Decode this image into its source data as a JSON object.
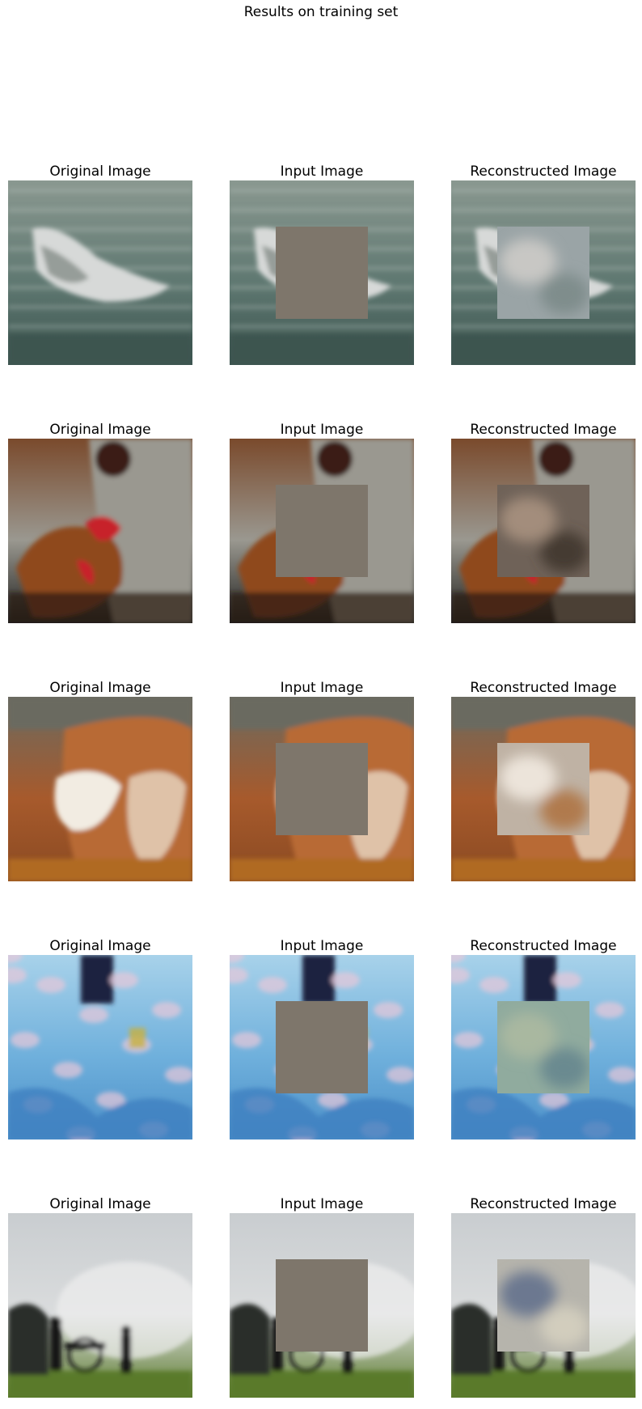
{
  "figure": {
    "title": "Results on training set",
    "column_titles": [
      "Original Image",
      "Input Image",
      "Reconstructed Image"
    ]
  },
  "colors": {
    "mask_fill": "#7e766b"
  },
  "rows": [
    {
      "scene": "whale",
      "palette": {
        "top": "#8a9890",
        "mid": "#5f7871",
        "bottom": "#3c5550",
        "subject": "#d7d9d8",
        "subject_dark": "#6b7470"
      },
      "recon": {
        "base": "#9aa4a6",
        "blob1": "#c8c7c4",
        "blob2": "#7f8d8c"
      }
    },
    {
      "scene": "rooster",
      "palette": {
        "top": "#7a4a2c",
        "mid": "#9a9890",
        "bottom": "#1e1e1c",
        "subject": "#c7202c",
        "subject_dark": "#8f4a1f"
      },
      "recon": {
        "base": "#6f6258",
        "blob1": "#a38d7c",
        "blob2": "#453a33"
      }
    },
    {
      "scene": "dog",
      "palette": {
        "top": "#6b6a60",
        "mid": "#a75a2c",
        "bottom": "#8a4a22",
        "subject": "#f2ece2",
        "subject_dark": "#b86a34"
      },
      "recon": {
        "base": "#bfb2a4",
        "blob1": "#ece4da",
        "blob2": "#b07a4e"
      }
    },
    {
      "scene": "shirt",
      "palette": {
        "top": "#a8d2ea",
        "mid": "#6fb0dc",
        "bottom": "#4b8fc8",
        "subject": "#e8c8d8",
        "subject_dark": "#1c2440"
      },
      "recon": {
        "base": "#90ab9e",
        "blob1": "#a9b8a0",
        "blob2": "#6a8a90"
      }
    },
    {
      "scene": "cannon",
      "palette": {
        "top": "#c9cdd0",
        "mid": "#dadcdd",
        "bottom": "#5a7a2a",
        "subject": "#2a2e2c",
        "subject_dark": "#141614"
      },
      "recon": {
        "base": "#b6b4ac",
        "blob1": "#6c7890",
        "blob2": "#d2cdbd"
      }
    }
  ]
}
